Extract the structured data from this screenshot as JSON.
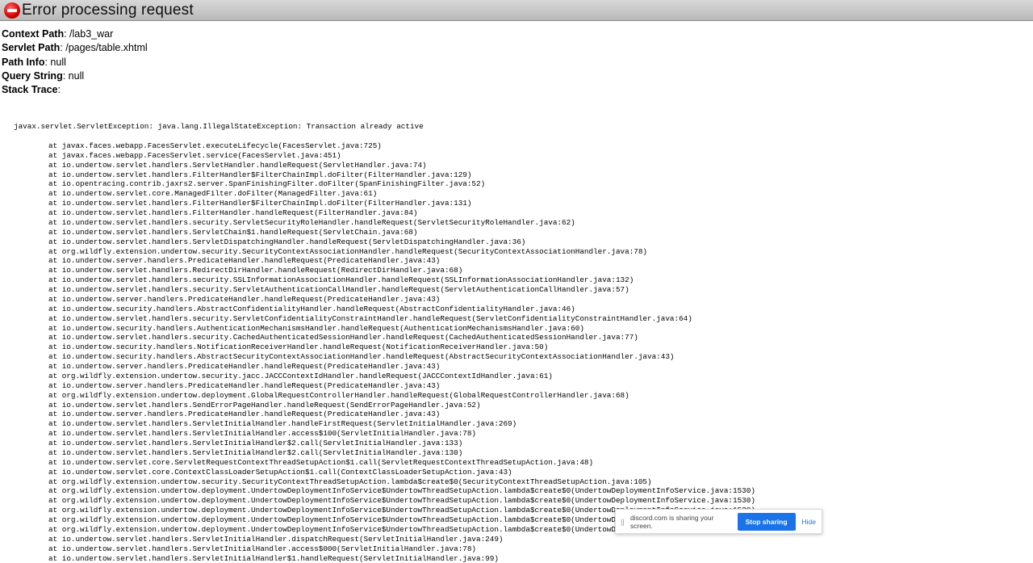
{
  "header": {
    "title": "Error processing request",
    "icon": "error-stop-icon"
  },
  "info": [
    {
      "label": "Context Path",
      "value": "/lab3_war"
    },
    {
      "label": "Servlet Path",
      "value": "/pages/table.xhtml"
    },
    {
      "label": "Path Info",
      "value": "null"
    },
    {
      "label": "Query String",
      "value": "null"
    },
    {
      "label": "Stack Trace",
      "value": ""
    }
  ],
  "trace": {
    "exception": "javax.servlet.ServletException: java.lang.IllegalStateException: Transaction already active",
    "frames": [
      "at javax.faces.webapp.FacesServlet.executeLifecycle(FacesServlet.java:725)",
      "at javax.faces.webapp.FacesServlet.service(FacesServlet.java:451)",
      "at io.undertow.servlet.handlers.ServletHandler.handleRequest(ServletHandler.java:74)",
      "at io.undertow.servlet.handlers.FilterHandler$FilterChainImpl.doFilter(FilterHandler.java:129)",
      "at io.opentracing.contrib.jaxrs2.server.SpanFinishingFilter.doFilter(SpanFinishingFilter.java:52)",
      "at io.undertow.servlet.core.ManagedFilter.doFilter(ManagedFilter.java:61)",
      "at io.undertow.servlet.handlers.FilterHandler$FilterChainImpl.doFilter(FilterHandler.java:131)",
      "at io.undertow.servlet.handlers.FilterHandler.handleRequest(FilterHandler.java:84)",
      "at io.undertow.servlet.handlers.security.ServletSecurityRoleHandler.handleRequest(ServletSecurityRoleHandler.java:62)",
      "at io.undertow.servlet.handlers.ServletChain$1.handleRequest(ServletChain.java:68)",
      "at io.undertow.servlet.handlers.ServletDispatchingHandler.handleRequest(ServletDispatchingHandler.java:36)",
      "at org.wildfly.extension.undertow.security.SecurityContextAssociationHandler.handleRequest(SecurityContextAssociationHandler.java:78)",
      "at io.undertow.server.handlers.PredicateHandler.handleRequest(PredicateHandler.java:43)",
      "at io.undertow.servlet.handlers.RedirectDirHandler.handleRequest(RedirectDirHandler.java:68)",
      "at io.undertow.servlet.handlers.security.SSLInformationAssociationHandler.handleRequest(SSLInformationAssociationHandler.java:132)",
      "at io.undertow.servlet.handlers.security.ServletAuthenticationCallHandler.handleRequest(ServletAuthenticationCallHandler.java:57)",
      "at io.undertow.server.handlers.PredicateHandler.handleRequest(PredicateHandler.java:43)",
      "at io.undertow.security.handlers.AbstractConfidentialityHandler.handleRequest(AbstractConfidentialityHandler.java:46)",
      "at io.undertow.servlet.handlers.security.ServletConfidentialityConstraintHandler.handleRequest(ServletConfidentialityConstraintHandler.java:64)",
      "at io.undertow.security.handlers.AuthenticationMechanismsHandler.handleRequest(AuthenticationMechanismsHandler.java:60)",
      "at io.undertow.servlet.handlers.security.CachedAuthenticatedSessionHandler.handleRequest(CachedAuthenticatedSessionHandler.java:77)",
      "at io.undertow.security.handlers.NotificationReceiverHandler.handleRequest(NotificationReceiverHandler.java:50)",
      "at io.undertow.security.handlers.AbstractSecurityContextAssociationHandler.handleRequest(AbstractSecurityContextAssociationHandler.java:43)",
      "at io.undertow.server.handlers.PredicateHandler.handleRequest(PredicateHandler.java:43)",
      "at org.wildfly.extension.undertow.security.jacc.JACCContextIdHandler.handleRequest(JACCContextIdHandler.java:61)",
      "at io.undertow.server.handlers.PredicateHandler.handleRequest(PredicateHandler.java:43)",
      "at org.wildfly.extension.undertow.deployment.GlobalRequestControllerHandler.handleRequest(GlobalRequestControllerHandler.java:68)",
      "at io.undertow.servlet.handlers.SendErrorPageHandler.handleRequest(SendErrorPageHandler.java:52)",
      "at io.undertow.server.handlers.PredicateHandler.handleRequest(PredicateHandler.java:43)",
      "at io.undertow.servlet.handlers.ServletInitialHandler.handleFirstRequest(ServletInitialHandler.java:269)",
      "at io.undertow.servlet.handlers.ServletInitialHandler.access$100(ServletInitialHandler.java:78)",
      "at io.undertow.servlet.handlers.ServletInitialHandler$2.call(ServletInitialHandler.java:133)",
      "at io.undertow.servlet.handlers.ServletInitialHandler$2.call(ServletInitialHandler.java:130)",
      "at io.undertow.servlet.core.ServletRequestContextThreadSetupAction$1.call(ServletRequestContextThreadSetupAction.java:48)",
      "at io.undertow.servlet.core.ContextClassLoaderSetupAction$1.call(ContextClassLoaderSetupAction.java:43)",
      "at org.wildfly.extension.undertow.security.SecurityContextThreadSetupAction.lambda$create$0(SecurityContextThreadSetupAction.java:105)",
      "at org.wildfly.extension.undertow.deployment.UndertowDeploymentInfoService$UndertowThreadSetupAction.lambda$create$0(UndertowDeploymentInfoService.java:1530)",
      "at org.wildfly.extension.undertow.deployment.UndertowDeploymentInfoService$UndertowThreadSetupAction.lambda$create$0(UndertowDeploymentInfoService.java:1530)",
      "at org.wildfly.extension.undertow.deployment.UndertowDeploymentInfoService$UndertowThreadSetupAction.lambda$create$0(UndertowDeploymentInfoService.java:1530)",
      "at org.wildfly.extension.undertow.deployment.UndertowDeploymentInfoService$UndertowThreadSetupAction.lambda$create$0(UndertowDeploymentInfoService.java:1530)",
      "at org.wildfly.extension.undertow.deployment.UndertowDeploymentInfoService$UndertowThreadSetupAction.lambda$create$0(UndertowDeploymentInfoService.java:1530)",
      "at io.undertow.servlet.handlers.ServletInitialHandler.dispatchRequest(ServletInitialHandler.java:249)",
      "at io.undertow.servlet.handlers.ServletInitialHandler.access$000(ServletInitialHandler.java:78)",
      "at io.undertow.servlet.handlers.ServletInitialHandler$1.handleRequest(ServletInitialHandler.java:99)"
    ]
  },
  "share_bar": {
    "message": "discord.com is sharing your screen.",
    "stop_label": "Stop sharing",
    "hide_label": "Hide",
    "grip": "||"
  },
  "colors": {
    "accent": "#1a73e8",
    "error": "#d20000"
  }
}
